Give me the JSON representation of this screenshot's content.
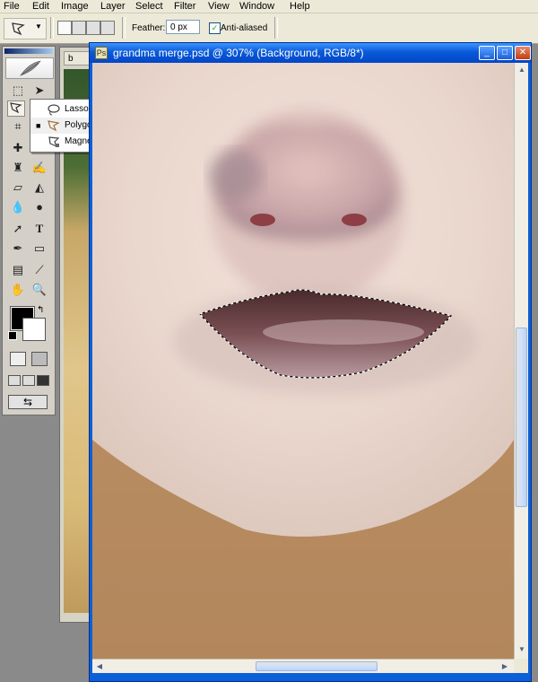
{
  "menubar": {
    "items": [
      "File",
      "Edit",
      "Image",
      "Layer",
      "Select",
      "Filter",
      "View",
      "Window",
      "Help"
    ]
  },
  "options": {
    "tool_icon": "polygonal-lasso-icon",
    "feather_label": "Feather:",
    "feather_value": "0 px",
    "antialias_label": "Anti-aliased",
    "antialias_checked": true
  },
  "background_doc": {
    "tab_label": "b"
  },
  "flyout": {
    "items": [
      {
        "label": "Lasso Tool",
        "key": "L",
        "selected": false,
        "icon": "lasso-icon"
      },
      {
        "label": "Polygonal Lasso Tool",
        "key": "L",
        "selected": true,
        "icon": "polygonal-lasso-icon"
      },
      {
        "label": "Magnetic Lasso Tool",
        "key": "L",
        "selected": false,
        "icon": "magnetic-lasso-icon"
      }
    ]
  },
  "toolbox": {
    "foreground_color": "#000000",
    "background_color": "#ffffff"
  },
  "document": {
    "title": "grandma merge.psd @ 307% (Background, RGB/8*)"
  },
  "colors": {
    "titlebar": "#0a5ad8",
    "chrome": "#ece9d8",
    "skin": "#e8d5cb",
    "neck": "#b88c61"
  }
}
